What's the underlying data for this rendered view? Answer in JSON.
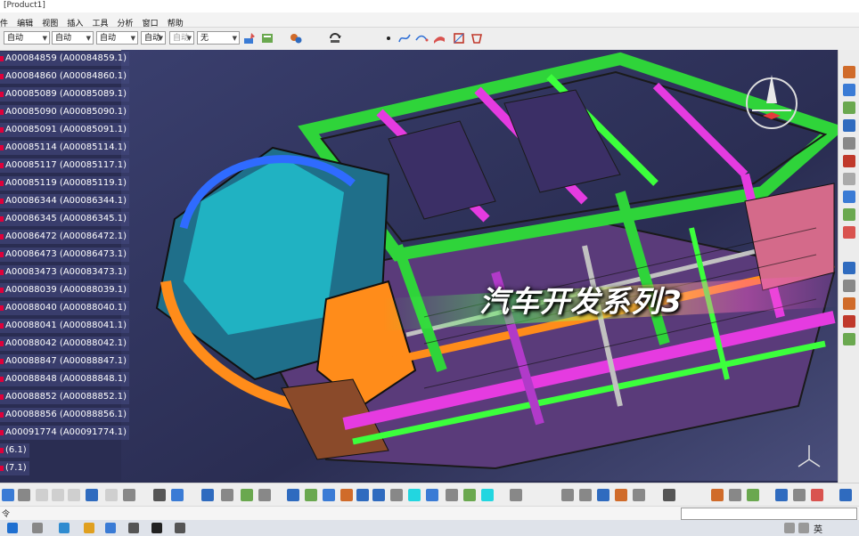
{
  "window": {
    "title": "[Product1]"
  },
  "menu": [
    "件",
    "编辑",
    "视图",
    "插入",
    "工具",
    "分析",
    "窗口",
    "帮助"
  ],
  "toolbar": {
    "combos": [
      {
        "value": "自动"
      },
      {
        "value": "自动"
      },
      {
        "value": "自动"
      },
      {
        "value": "自动"
      },
      {
        "value": "自动"
      },
      {
        "value": "无"
      }
    ]
  },
  "tree": {
    "nodes": [
      "A00084859 (A00084859.1)",
      "A00084860 (A00084860.1)",
      "A00085089 (A00085089.1)",
      "A00085090 (A00085090.1)",
      "A00085091 (A00085091.1)",
      "A00085114 (A00085114.1)",
      "A00085117 (A00085117.1)",
      "A00085119 (A00085119.1)",
      "A00086344 (A00086344.1)",
      "A00086345 (A00086345.1)",
      "A00086472 (A00086472.1)",
      "A00086473 (A00086473.1)",
      "A00083473 (A00083473.1)",
      "A00088039 (A00088039.1)",
      "A00088040 (A00088040.1)",
      "A00088041 (A00088041.1)",
      "A00088042 (A00088042.1)",
      "A00088847 (A00088847.1)",
      "A00088848 (A00088848.1)",
      "A00088852 (A00088852.1)",
      "A00088856 (A00088856.1)",
      "A00091774 (A00091774.1)",
      "(6.1)",
      "(7.1)"
    ]
  },
  "overlay": {
    "title": "汽车开发系列3"
  },
  "status": {
    "left": "令"
  },
  "taskbar": {
    "lang": "英"
  },
  "colors": {
    "viewport_bg": "#2a2d52",
    "tree_bg": "#464b82",
    "accent_green": "#3cff3c",
    "accent_magenta": "#e53be0",
    "accent_orange": "#ff8c1a",
    "accent_cyan": "#22d6e0"
  },
  "icons": [
    "save-icon",
    "print-icon",
    "cut-icon",
    "copy-icon",
    "paste-icon",
    "undo-icon",
    "redo-icon",
    "formula-icon",
    "pan-icon",
    "rotate-icon",
    "zoom-in-icon",
    "zoom-out-icon",
    "fit-all-icon",
    "view-icon",
    "compass-icon",
    "axis-icon"
  ]
}
